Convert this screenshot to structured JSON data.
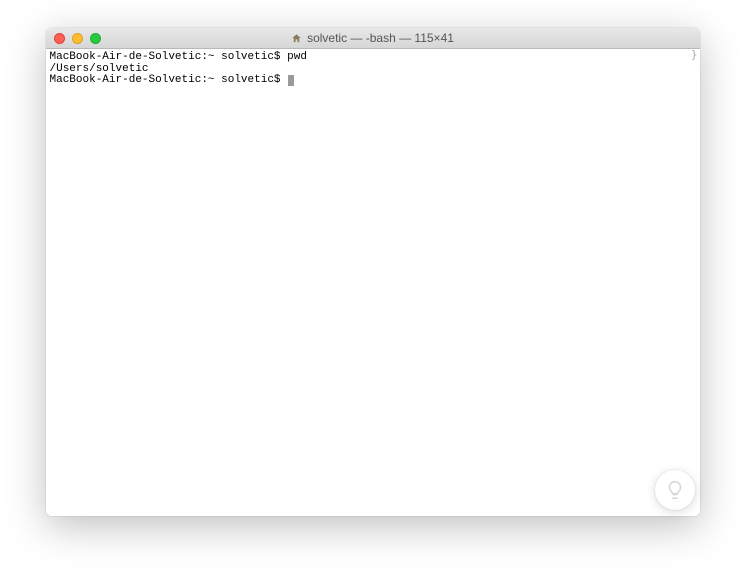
{
  "window": {
    "title": "solvetic — -bash — 115×41"
  },
  "terminal": {
    "line1_prompt": "MacBook-Air-de-Solvetic:~ solvetic$ ",
    "line1_cmd": "pwd",
    "line2_output": "/Users/solvetic",
    "line3_prompt": "MacBook-Air-de-Solvetic:~ solvetic$ "
  }
}
